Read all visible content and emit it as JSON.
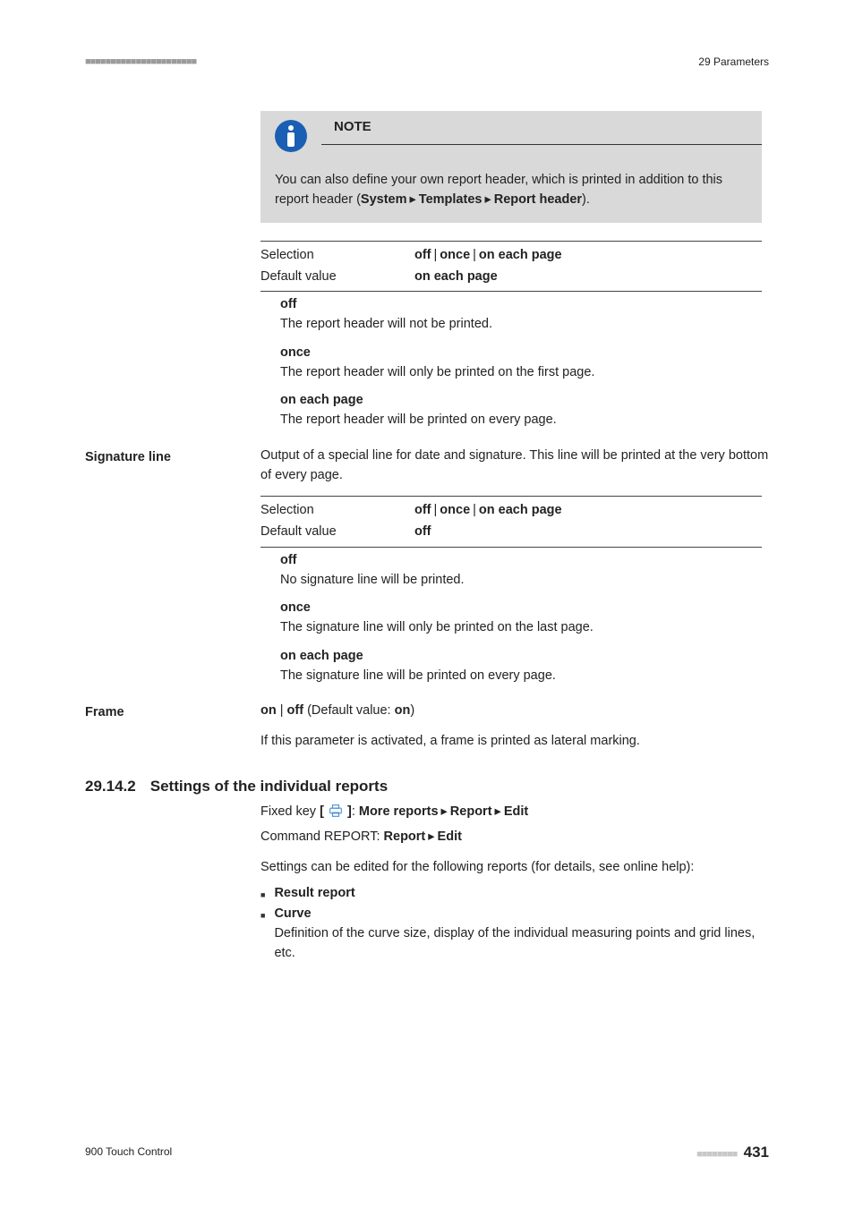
{
  "header": {
    "left_dashes": "■■■■■■■■■■■■■■■■■■■■■■",
    "right": "29 Parameters"
  },
  "note": {
    "title": "NOTE",
    "body_1": "You can also define your own report header, which is printed in addition to this report header (",
    "body_path_1": "System",
    "body_path_2": "Templates",
    "body_path_3": "Report header",
    "body_end": ")."
  },
  "report_header_kv": {
    "selection_label": "Selection",
    "selection_value_1": "off",
    "selection_value_2": "once",
    "selection_value_3": "on each page",
    "default_label": "Default value",
    "default_value": "on each page"
  },
  "report_header_opts": {
    "off_term": "off",
    "off_desc": "The report header will not be printed.",
    "once_term": "once",
    "once_desc": "The report header will only be printed on the first page.",
    "each_term": "on each page",
    "each_desc": "The report header will be printed on every page."
  },
  "sigline": {
    "label": "Signature line",
    "intro": "Output of a special line for date and signature. This line will be printed at the very bottom of every page.",
    "kv": {
      "selection_label": "Selection",
      "selection_value_1": "off",
      "selection_value_2": "once",
      "selection_value_3": "on each page",
      "default_label": "Default value",
      "default_value": "off"
    },
    "opts": {
      "off_term": "off",
      "off_desc": "No signature line will be printed.",
      "once_term": "once",
      "once_desc": "The signature line will only be printed on the last page.",
      "each_term": "on each page",
      "each_desc": "The signature line will be printed on every page."
    }
  },
  "frame": {
    "label": "Frame",
    "toggle_on": "on",
    "toggle_off": "off",
    "default_prefix": " (Default value: ",
    "default_value": "on",
    "default_suffix": ")",
    "desc": "If this parameter is activated, a frame is printed as lateral marking."
  },
  "section": {
    "num": "29.14.2",
    "title": "Settings of the individual reports",
    "fixed_prefix": "Fixed key ",
    "fixed_open": "[ ",
    "fixed_close": " ]",
    "fixed_colon": ": ",
    "fixed_path_1": "More reports",
    "fixed_path_2": "Report",
    "fixed_path_3": "Edit",
    "cmd_prefix": "Command REPORT: ",
    "cmd_path_1": "Report",
    "cmd_path_2": "Edit",
    "intro": "Settings can be edited for the following reports (for details, see online help):",
    "bullets": {
      "result_title": "Result report",
      "curve_title": "Curve",
      "curve_desc": "Definition of the curve size, display of the individual measuring points and grid lines, etc."
    }
  },
  "footer": {
    "left": "900 Touch Control",
    "right_dashes": "■■■■■■■■",
    "page": "431"
  }
}
